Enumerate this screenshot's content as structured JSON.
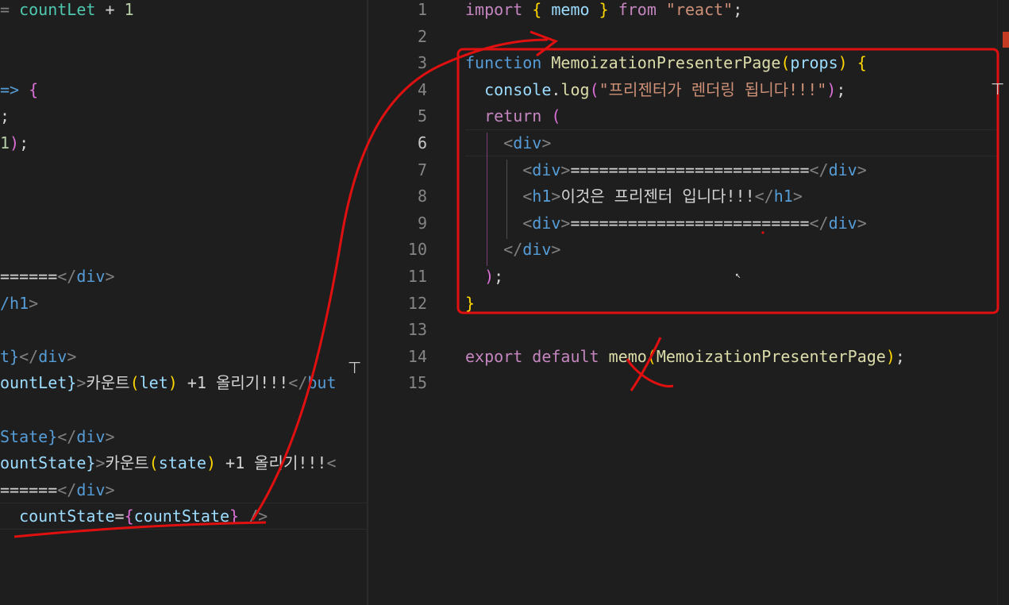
{
  "left_editor": {
    "lines": [
      {
        "parts": [
          [
            "punc",
            "= "
          ],
          [
            "grn",
            "countLet"
          ],
          [
            "txt",
            " + "
          ],
          [
            "num",
            "1"
          ]
        ]
      },
      {
        "parts": []
      },
      {
        "parts": []
      },
      {
        "parts": [
          [
            "kw2",
            "=> "
          ],
          [
            "br2",
            "{"
          ]
        ]
      },
      {
        "parts": [
          [
            "txt",
            ";"
          ]
        ]
      },
      {
        "parts": [
          [
            "num",
            "1"
          ],
          [
            "br2",
            ")"
          ],
          [
            "txt",
            ";"
          ]
        ]
      },
      {
        "parts": []
      },
      {
        "parts": []
      },
      {
        "parts": []
      },
      {
        "parts": []
      },
      {
        "parts": [
          [
            "txt",
            "======"
          ],
          [
            "punc",
            "</"
          ],
          [
            "tag",
            "div"
          ],
          [
            "punc",
            ">"
          ]
        ]
      },
      {
        "parts": [
          [
            "tag",
            "/h1"
          ],
          [
            "punc",
            ">"
          ]
        ]
      },
      {
        "parts": []
      },
      {
        "parts": [
          [
            "kw2",
            "t}"
          ],
          [
            "punc",
            "</"
          ],
          [
            "tag",
            "div"
          ],
          [
            "punc",
            ">"
          ]
        ]
      },
      {
        "parts": [
          [
            "var",
            "ountLet}"
          ],
          [
            "punc",
            ">"
          ],
          [
            "txt",
            "카운트"
          ],
          [
            "br",
            "("
          ],
          [
            "var",
            "let"
          ],
          [
            "br",
            ")"
          ],
          [
            "txt",
            " +1 올리기!!!"
          ],
          [
            "punc",
            "</"
          ],
          [
            "tag",
            "but"
          ]
        ]
      },
      {
        "parts": []
      },
      {
        "parts": [
          [
            "kw2",
            "State}"
          ],
          [
            "punc",
            "</"
          ],
          [
            "tag",
            "div"
          ],
          [
            "punc",
            ">"
          ]
        ]
      },
      {
        "parts": [
          [
            "var",
            "ountState}"
          ],
          [
            "punc",
            ">"
          ],
          [
            "txt",
            "카운트"
          ],
          [
            "br",
            "("
          ],
          [
            "var",
            "state"
          ],
          [
            "br",
            ")"
          ],
          [
            "txt",
            " +1 올리기!!!"
          ],
          [
            "punc",
            "<"
          ]
        ]
      },
      {
        "parts": [
          [
            "txt",
            "======"
          ],
          [
            "punc",
            "</"
          ],
          [
            "tag",
            "div"
          ],
          [
            "punc",
            ">"
          ]
        ]
      },
      {
        "parts": [
          [
            "txt",
            "  "
          ],
          [
            "var",
            "countState"
          ],
          [
            "txt",
            "="
          ],
          [
            "br2",
            "{"
          ],
          [
            "var",
            "countState"
          ],
          [
            "br2",
            "}"
          ],
          [
            "punc",
            " />"
          ]
        ]
      }
    ]
  },
  "right_editor": {
    "line_numbers": [
      "1",
      "2",
      "3",
      "4",
      "5",
      "6",
      "7",
      "8",
      "9",
      "10",
      "11",
      "12",
      "13",
      "14",
      "15"
    ],
    "active_line": "6",
    "lines": [
      {
        "parts": [
          [
            "kw",
            "import "
          ],
          [
            "br",
            "{ "
          ],
          [
            "var",
            "memo"
          ],
          [
            "br",
            " }"
          ],
          [
            "kw",
            " from "
          ],
          [
            "str",
            "\"react\""
          ],
          [
            "txt",
            ";"
          ]
        ]
      },
      {
        "parts": []
      },
      {
        "parts": [
          [
            "kw2",
            "function "
          ],
          [
            "fn",
            "MemoizationPresenterPage"
          ],
          [
            "br",
            "("
          ],
          [
            "var",
            "props"
          ],
          [
            "br",
            ")"
          ],
          [
            "txt",
            " "
          ],
          [
            "br",
            "{"
          ]
        ]
      },
      {
        "parts": [
          [
            "txt",
            "  "
          ],
          [
            "var",
            "console"
          ],
          [
            "txt",
            "."
          ],
          [
            "fn",
            "log"
          ],
          [
            "br2",
            "("
          ],
          [
            "str",
            "\"프리젠터가 렌더링 됩니다!!!\""
          ],
          [
            "br2",
            ")"
          ],
          [
            "txt",
            ";"
          ]
        ]
      },
      {
        "parts": [
          [
            "txt",
            "  "
          ],
          [
            "kw",
            "return "
          ],
          [
            "br2",
            "("
          ]
        ]
      },
      {
        "parts": [
          [
            "txt",
            "    "
          ],
          [
            "punc",
            "<"
          ],
          [
            "tag",
            "div"
          ],
          [
            "punc",
            ">"
          ]
        ]
      },
      {
        "parts": [
          [
            "txt",
            "      "
          ],
          [
            "punc",
            "<"
          ],
          [
            "tag",
            "div"
          ],
          [
            "punc",
            ">"
          ],
          [
            "txt",
            "========================="
          ],
          [
            "punc",
            "</"
          ],
          [
            "tag",
            "div"
          ],
          [
            "punc",
            ">"
          ]
        ]
      },
      {
        "parts": [
          [
            "txt",
            "      "
          ],
          [
            "punc",
            "<"
          ],
          [
            "tag",
            "h1"
          ],
          [
            "punc",
            ">"
          ],
          [
            "txt",
            "이것은 프리젠터 입니다!!!"
          ],
          [
            "punc",
            "</"
          ],
          [
            "tag",
            "h1"
          ],
          [
            "punc",
            ">"
          ]
        ]
      },
      {
        "parts": [
          [
            "txt",
            "      "
          ],
          [
            "punc",
            "<"
          ],
          [
            "tag",
            "div"
          ],
          [
            "punc",
            ">"
          ],
          [
            "txt",
            "========================="
          ],
          [
            "punc",
            "</"
          ],
          [
            "tag",
            "div"
          ],
          [
            "punc",
            ">"
          ]
        ]
      },
      {
        "parts": [
          [
            "txt",
            "    "
          ],
          [
            "punc",
            "</"
          ],
          [
            "tag",
            "div"
          ],
          [
            "punc",
            ">"
          ]
        ]
      },
      {
        "parts": [
          [
            "txt",
            "  "
          ],
          [
            "br2",
            ")"
          ],
          [
            "txt",
            ";"
          ]
        ]
      },
      {
        "parts": [
          [
            "br",
            "}"
          ]
        ]
      },
      {
        "parts": []
      },
      {
        "parts": [
          [
            "kw",
            "export "
          ],
          [
            "kw",
            "default "
          ],
          [
            "fn",
            "memo"
          ],
          [
            "br",
            "("
          ],
          [
            "fn",
            "MemoizationPresenterPage"
          ],
          [
            "br",
            ")"
          ],
          [
            "txt",
            ";"
          ]
        ]
      },
      {
        "parts": []
      }
    ]
  },
  "annotation": {
    "stroke_color": "#e01010",
    "highlight_box_label": "function-block-highlight",
    "strike_target": "memo"
  },
  "mouse_cursor": "arrow-cursor-icon"
}
